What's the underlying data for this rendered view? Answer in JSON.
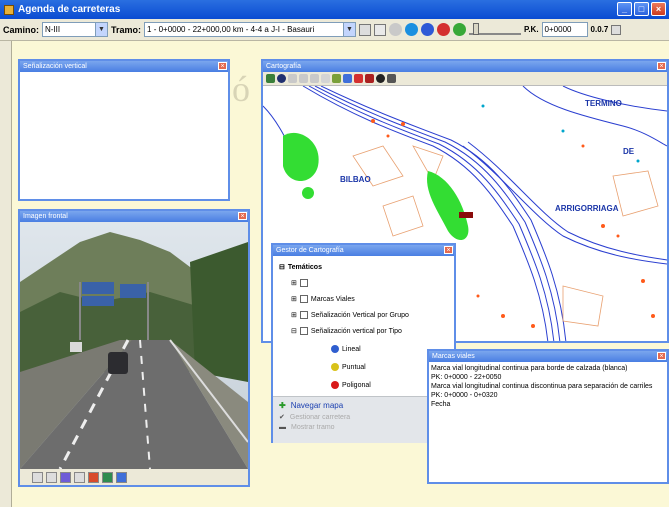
{
  "window": {
    "title": "Agenda de carreteras",
    "minimize": "_",
    "maximize": "□",
    "close": "×"
  },
  "toolbar": {
    "camino_label": "Camino:",
    "camino_value": "N-III",
    "tramo_label": "Tramo:",
    "tramo_value": "1 - 0+0000 - 22+000,00 km - 4-4 a J-I - Basauri",
    "pk_label": "P.K.",
    "pk_value": "0+0000",
    "counter": "0.0.7"
  },
  "watermark": "ó",
  "panels": {
    "vertical_signs": {
      "title": "Señalización vertical",
      "close": "×"
    },
    "map": {
      "title": "Cartografía",
      "close": "×"
    },
    "camera": {
      "title": "Imagen frontal",
      "close": "×"
    },
    "layers": {
      "title": "Gestor de Cartografía",
      "close": "×"
    },
    "list": {
      "title": "Marcas viales",
      "close": "×"
    }
  },
  "map_labels": [
    "TERMINO",
    "DE",
    "ARRIGORRIAGA",
    "BILBAO"
  ],
  "layers": {
    "root": "Temáticos",
    "items": [
      "",
      "Marcas Viales",
      "Señalización Vertical por Grupo",
      "Señalización vertical por Tipo"
    ],
    "legend": [
      "Lineal",
      "Puntual",
      "Poligonal"
    ],
    "legend_colors": [
      "#2f5ecf",
      "#d8c21a",
      "#d81a1a"
    ],
    "buttons": [
      "Navegar mapa",
      "Gestionar carretera",
      "Mostrar tramo"
    ]
  },
  "list": {
    "lines": [
      "Marca vial longitudinal continua para borde de calzada (blanca)",
      "  PK: 0+0000 - 22+0050",
      "Marca vial longitudinal continua discontinua para separación de carriles",
      "  PK: 0+0000 - 0+0320",
      "Fecha"
    ]
  },
  "colors": {
    "title_bar": "#0a4bd2",
    "panel_border": "#5f8ee8",
    "background": "#fbf8d6"
  }
}
